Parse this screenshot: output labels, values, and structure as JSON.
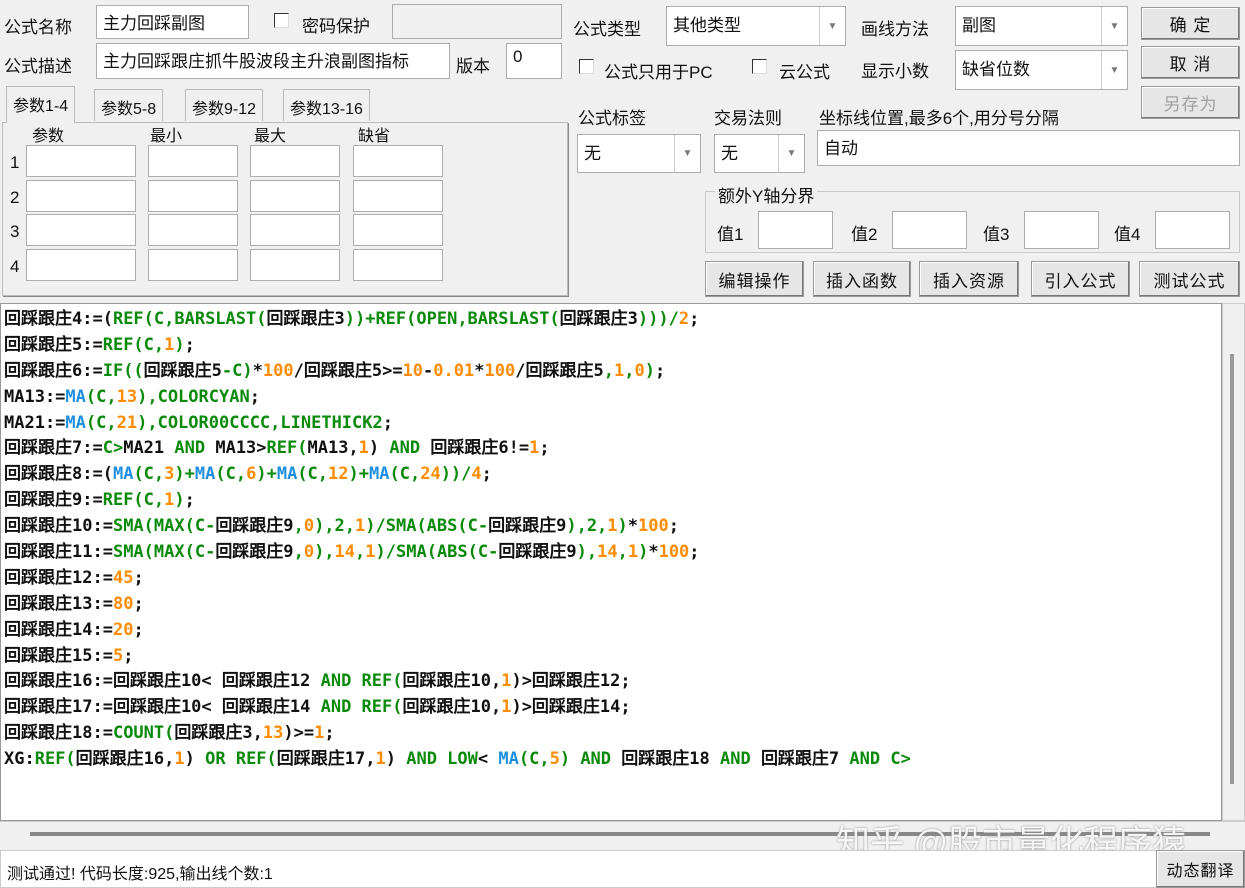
{
  "header": {
    "name_label": "公式名称",
    "name_value": "主力回踩副图",
    "password_label": "密码保护",
    "password_value": "",
    "desc_label": "公式描述",
    "desc_value": "主力回踩跟庄抓牛股波段主升浪副图指标",
    "version_label": "版本",
    "version_value": "0",
    "type_label": "公式类型",
    "type_value": "其他类型",
    "draw_label": "画线方法",
    "draw_value": "副图",
    "pc_only_label": "公式只用于PC",
    "cloud_label": "云公式",
    "decimal_label": "显示小数",
    "decimal_value": "缺省位数",
    "ok": "确  定",
    "cancel": "取  消",
    "save_as": "另存为"
  },
  "params": {
    "tabs": [
      "参数1-4",
      "参数5-8",
      "参数9-12",
      "参数13-16"
    ],
    "columns": [
      "参数",
      "最小",
      "最大",
      "缺省"
    ],
    "rows": [
      "1",
      "2",
      "3",
      "4"
    ]
  },
  "options": {
    "tag_label": "公式标签",
    "tag_value": "无",
    "trade_label": "交易法则",
    "trade_value": "无",
    "axis_label": "坐标线位置,最多6个,用分号分隔",
    "axis_value": "自动",
    "yaxis_group": "额外Y轴分界",
    "values": [
      "值1",
      "值2",
      "值3",
      "值4"
    ]
  },
  "toolbar": [
    "编辑操作",
    "插入函数",
    "插入资源",
    "引入公式",
    "测试公式"
  ],
  "colors": {
    "keyword": "#0a8a0a",
    "number": "#ff8c00",
    "ma": "#1e8fe0",
    "text": "#111111"
  },
  "code": [
    [
      [
        "k",
        "回踩跟庄4:=("
      ],
      [
        "g",
        "REF(C,BARSLAST("
      ],
      [
        "k",
        "回踩跟庄3"
      ],
      [
        "g",
        "))+REF(OPEN,BARSLAST("
      ],
      [
        "k",
        "回踩跟庄3"
      ],
      [
        "g",
        ")))/"
      ],
      [
        "o",
        "2"
      ],
      [
        "k",
        ";"
      ]
    ],
    [
      [
        "k",
        "回踩跟庄5:="
      ],
      [
        "g",
        "REF(C,"
      ],
      [
        "o",
        "1"
      ],
      [
        "g",
        ")"
      ],
      [
        "k",
        ";"
      ]
    ],
    [
      [
        "k",
        "回踩跟庄6:="
      ],
      [
        "g",
        "IF(("
      ],
      [
        "k",
        "回踩跟庄5"
      ],
      [
        "g",
        "-C)"
      ],
      [
        "k",
        "*"
      ],
      [
        "o",
        "100"
      ],
      [
        "k",
        "/回踩跟庄5>="
      ],
      [
        "o",
        "10"
      ],
      [
        "k",
        "-"
      ],
      [
        "o",
        "0.01"
      ],
      [
        "k",
        "*"
      ],
      [
        "o",
        "100"
      ],
      [
        "k",
        "/回踩跟庄5"
      ],
      [
        "g",
        ","
      ],
      [
        "o",
        "1"
      ],
      [
        "g",
        ","
      ],
      [
        "o",
        "0"
      ],
      [
        "g",
        ")"
      ],
      [
        "k",
        ";"
      ]
    ],
    [
      [
        "k",
        "MA13:="
      ],
      [
        "b",
        "MA"
      ],
      [
        "g",
        "(C,"
      ],
      [
        "o",
        "13"
      ],
      [
        "g",
        "),COLORCYAN"
      ],
      [
        "k",
        ";"
      ]
    ],
    [
      [
        "k",
        "MA21:="
      ],
      [
        "b",
        "MA"
      ],
      [
        "g",
        "(C,"
      ],
      [
        "o",
        "21"
      ],
      [
        "g",
        "),COLOR00CCCC,LINETHICK2"
      ],
      [
        "k",
        ";"
      ]
    ],
    [
      [
        "k",
        "回踩跟庄7:="
      ],
      [
        "g",
        "C>"
      ],
      [
        "k",
        "MA21"
      ],
      [
        "g",
        " AND "
      ],
      [
        "k",
        "MA13>"
      ],
      [
        "g",
        "REF("
      ],
      [
        "k",
        "MA13,"
      ],
      [
        "o",
        "1"
      ],
      [
        "k",
        ")"
      ],
      [
        "g",
        " AND "
      ],
      [
        "k",
        "回踩跟庄6!="
      ],
      [
        "o",
        "1"
      ],
      [
        "k",
        ";"
      ]
    ],
    [
      [
        "k",
        "回踩跟庄8:=("
      ],
      [
        "b",
        "MA"
      ],
      [
        "g",
        "(C,"
      ],
      [
        "o",
        "3"
      ],
      [
        "g",
        ")+"
      ],
      [
        "b",
        "MA"
      ],
      [
        "g",
        "(C,"
      ],
      [
        "o",
        "6"
      ],
      [
        "g",
        ")+"
      ],
      [
        "b",
        "MA"
      ],
      [
        "g",
        "(C,"
      ],
      [
        "o",
        "12"
      ],
      [
        "g",
        ")+"
      ],
      [
        "b",
        "MA"
      ],
      [
        "g",
        "(C,"
      ],
      [
        "o",
        "24"
      ],
      [
        "g",
        "))/"
      ],
      [
        "o",
        "4"
      ],
      [
        "k",
        ";"
      ]
    ],
    [
      [
        "k",
        "回踩跟庄9:="
      ],
      [
        "g",
        "REF(C,"
      ],
      [
        "o",
        "1"
      ],
      [
        "g",
        ")"
      ],
      [
        "k",
        ";"
      ]
    ],
    [
      [
        "k",
        "回踩跟庄10:="
      ],
      [
        "g",
        "SMA(MAX(C-"
      ],
      [
        "k",
        "回踩跟庄9"
      ],
      [
        "g",
        ","
      ],
      [
        "o",
        "0"
      ],
      [
        "g",
        "),2,"
      ],
      [
        "o",
        "1"
      ],
      [
        "g",
        ")/SMA(ABS(C-"
      ],
      [
        "k",
        "回踩跟庄9"
      ],
      [
        "g",
        "),2,"
      ],
      [
        "o",
        "1"
      ],
      [
        "g",
        ")"
      ],
      [
        "k",
        "*"
      ],
      [
        "o",
        "100"
      ],
      [
        "k",
        ";"
      ]
    ],
    [
      [
        "k",
        "回踩跟庄11:="
      ],
      [
        "g",
        "SMA(MAX(C-"
      ],
      [
        "k",
        "回踩跟庄9"
      ],
      [
        "g",
        ","
      ],
      [
        "o",
        "0"
      ],
      [
        "g",
        "),"
      ],
      [
        "o",
        "14"
      ],
      [
        "g",
        ","
      ],
      [
        "o",
        "1"
      ],
      [
        "g",
        ")/SMA(ABS(C-"
      ],
      [
        "k",
        "回踩跟庄9"
      ],
      [
        "g",
        "),"
      ],
      [
        "o",
        "14"
      ],
      [
        "g",
        ","
      ],
      [
        "o",
        "1"
      ],
      [
        "g",
        ")"
      ],
      [
        "k",
        "*"
      ],
      [
        "o",
        "100"
      ],
      [
        "k",
        ";"
      ]
    ],
    [
      [
        "k",
        "回踩跟庄12:="
      ],
      [
        "o",
        "45"
      ],
      [
        "k",
        ";"
      ]
    ],
    [
      [
        "k",
        "回踩跟庄13:="
      ],
      [
        "o",
        "80"
      ],
      [
        "k",
        ";"
      ]
    ],
    [
      [
        "k",
        "回踩跟庄14:="
      ],
      [
        "o",
        "20"
      ],
      [
        "k",
        ";"
      ]
    ],
    [
      [
        "k",
        "回踩跟庄15:="
      ],
      [
        "o",
        "5"
      ],
      [
        "k",
        ";"
      ]
    ],
    [
      [
        "k",
        "回踩跟庄16:=回踩跟庄10< 回踩跟庄12"
      ],
      [
        "g",
        " AND REF("
      ],
      [
        "k",
        "回踩跟庄10,"
      ],
      [
        "o",
        "1"
      ],
      [
        "k",
        ")>回踩跟庄12;"
      ]
    ],
    [
      [
        "k",
        "回踩跟庄17:=回踩跟庄10< 回踩跟庄14"
      ],
      [
        "g",
        " AND REF("
      ],
      [
        "k",
        "回踩跟庄10,"
      ],
      [
        "o",
        "1"
      ],
      [
        "k",
        ")>回踩跟庄14;"
      ]
    ],
    [
      [
        "k",
        "回踩跟庄18:="
      ],
      [
        "g",
        "COUNT("
      ],
      [
        "k",
        "回踩跟庄3,"
      ],
      [
        "o",
        "13"
      ],
      [
        "k",
        ")>="
      ],
      [
        "o",
        "1"
      ],
      [
        "k",
        ";"
      ]
    ],
    [
      [
        "k",
        "XG:"
      ],
      [
        "g",
        "REF("
      ],
      [
        "k",
        "回踩跟庄16,"
      ],
      [
        "o",
        "1"
      ],
      [
        "k",
        ")"
      ],
      [
        "g",
        " OR REF("
      ],
      [
        "k",
        "回踩跟庄17,"
      ],
      [
        "o",
        "1"
      ],
      [
        "k",
        ")"
      ],
      [
        "g",
        " AND LOW"
      ],
      [
        "k",
        "< "
      ],
      [
        "b",
        "MA"
      ],
      [
        "g",
        "(C,"
      ],
      [
        "o",
        "5"
      ],
      [
        "g",
        ")"
      ],
      [
        "g",
        " AND "
      ],
      [
        "k",
        "回踩跟庄18"
      ],
      [
        "g",
        " AND "
      ],
      [
        "k",
        "回踩跟庄7"
      ],
      [
        "g",
        " AND C>"
      ]
    ]
  ],
  "status": {
    "text": "测试通过! 代码长度:925,输出线个数:1",
    "translate": "动态翻译"
  },
  "watermark": "知乎 @股市量化程序猿"
}
